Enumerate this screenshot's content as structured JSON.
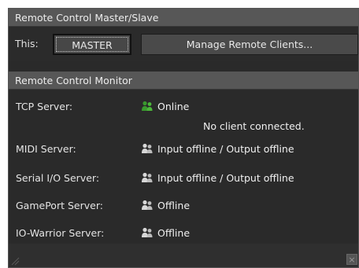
{
  "master_slave": {
    "title": "Remote Control Master/Slave",
    "this_label": "This:",
    "master_button": "MASTER",
    "manage_button": "Manage Remote Clients..."
  },
  "monitor": {
    "title": "Remote Control Monitor",
    "rows": [
      {
        "label": "TCP Server:",
        "status": "Online",
        "icon": "user-online-icon",
        "detail": "No client connected."
      },
      {
        "label": "MIDI Server:",
        "status": "Input offline / Output offline",
        "icon": "user-offline-icon"
      },
      {
        "label": "Serial I/O Server:",
        "status": "Input offline / Output offline",
        "icon": "user-offline-icon"
      },
      {
        "label": "GamePort Server:",
        "status": "Offline",
        "icon": "user-offline-icon"
      },
      {
        "label": "IO-Warrior Server:",
        "status": "Offline",
        "icon": "user-offline-icon"
      }
    ]
  },
  "footer": {
    "close_glyph": "×"
  },
  "colors": {
    "online": "#3a9a2e",
    "offline": "#d8d8d8"
  }
}
